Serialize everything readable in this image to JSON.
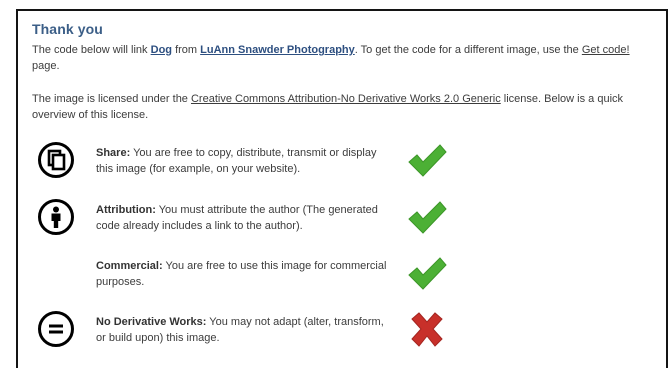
{
  "heading": "Thank you",
  "intro": {
    "text_before": "The code below will link ",
    "image_link": "Dog",
    "text_from": " from ",
    "author_link": "LuAnn Snawder Photography",
    "text_after": ". To get the code for a different image, use the ",
    "get_code_link": "Get code!",
    "text_end": " page."
  },
  "license_intro": {
    "text_before": "The image is licensed under the ",
    "license_link": "Creative Commons Attribution-No Derivative Works 2.0 Generic",
    "text_after": " license. Below is a quick overview of this license."
  },
  "terms": [
    {
      "title": "Share:",
      "desc": " You are free to copy, distribute, transmit or display this image (for example, on your website).",
      "icon": "share-icon",
      "allowed": true
    },
    {
      "title": "Attribution:",
      "desc": " You must attribute the author (The generated code already includes a link to the author).",
      "icon": "attribution-icon",
      "allowed": true
    },
    {
      "title": "Commercial:",
      "desc": " You are free to use this image for commercial purposes.",
      "icon": "",
      "allowed": true
    },
    {
      "title": "No Derivative Works:",
      "desc": " You may not adapt (alter, transform, or build upon) this image.",
      "icon": "no-derivatives-icon",
      "allowed": false
    }
  ],
  "colors": {
    "heading": "#3b5e87",
    "check": "#4cb035",
    "cross": "#c8302a",
    "link": "#2d4f80"
  }
}
